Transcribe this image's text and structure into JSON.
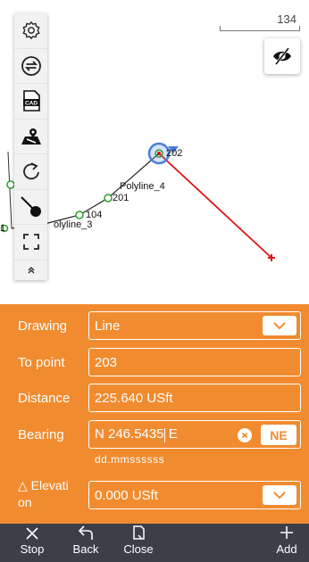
{
  "map": {
    "scale_label": "134",
    "points": {
      "p202": "202",
      "p201": "201",
      "p104": "104",
      "p_left": "1"
    },
    "polylines": {
      "poly4": "Polyline_4",
      "poly3": "olyline_3"
    },
    "toolbar": [
      {
        "name": "settings-icon"
      },
      {
        "name": "switch-icon"
      },
      {
        "name": "cad-icon"
      },
      {
        "name": "map-layer-icon"
      },
      {
        "name": "rotate-icon"
      },
      {
        "name": "locate-point-icon"
      },
      {
        "name": "fullscreen-icon"
      },
      {
        "name": "collapse-icon"
      }
    ],
    "cad_badge": "CAD"
  },
  "form": {
    "drawing_label": "Drawing",
    "drawing_value": "Line",
    "to_point_label": "To point",
    "to_point_value": "203",
    "distance_label": "Distance",
    "distance_value": "225.640 USft",
    "bearing_label": "Bearing",
    "bearing_value_before_cursor": "N 246.5435",
    "bearing_value_after_cursor": " E",
    "bearing_quadrant": "NE",
    "bearing_format_hint": "dd.mmssssss",
    "elevation_label_line1": "△ Elevati",
    "elevation_label_line2": "on",
    "elevation_value": "0.000 USft"
  },
  "bottom_bar": {
    "stop": "Stop",
    "back": "Back",
    "close": "Close",
    "add": "Add"
  },
  "colors": {
    "panel": "#f18b2f",
    "bottom_bar": "#3d3f47",
    "active_line": "#e00000",
    "point_ring": "#2aa02a"
  }
}
